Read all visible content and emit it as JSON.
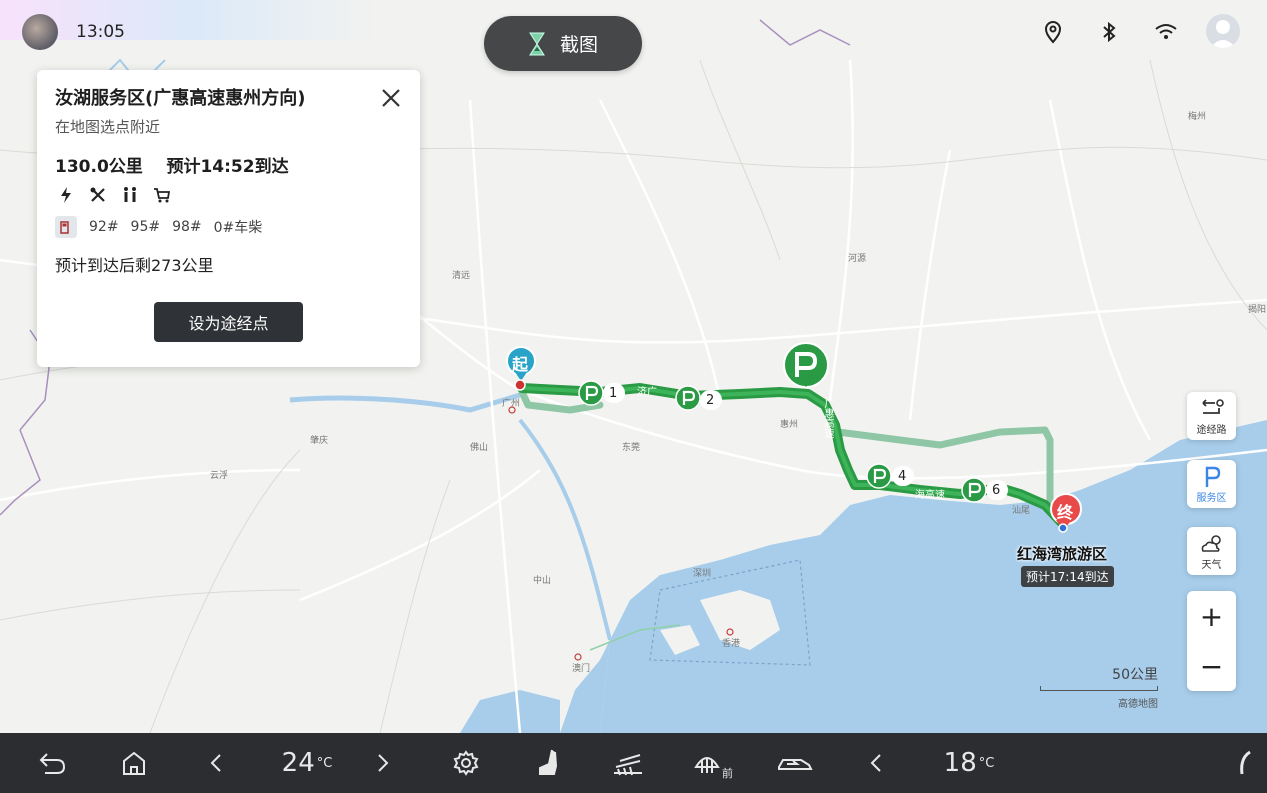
{
  "status": {
    "time": "13:05",
    "screenshot_label": "截图"
  },
  "card": {
    "title": "汝湖服务区(广惠高速惠州方向)",
    "subtitle": "在地图选点附近",
    "distance": "130.0公里",
    "eta": "预计14:52到达",
    "fuel": [
      "92#",
      "95#",
      "98#",
      "0#车柴"
    ],
    "remaining": "预计到达后剩273公里",
    "button": "设为途经点"
  },
  "side": {
    "waypoint": "途经路",
    "service_area": "服务区",
    "weather": "天气"
  },
  "map": {
    "start_marker": "起",
    "end_marker": "终",
    "destination": "红海湾旅游区",
    "dest_eta": "预计17:14到达",
    "scale": "50公里",
    "brand": "高德地图",
    "markers": [
      "1",
      "2",
      "4",
      "6"
    ],
    "cities": {
      "guangzhou": "广州",
      "foshan": "佛山",
      "dongguan": "东莞",
      "huizhou": "惠州",
      "shenzhen": "深圳",
      "zhongshan": "中山",
      "macau": "澳门",
      "hongkong": "香港",
      "zhaoqing": "肇庆",
      "yunfu": "云浮",
      "qingyuan": "清远",
      "heyuan": "河源",
      "meizhou": "梅州",
      "jieyang": "揭阳",
      "shanwei": "汕尾"
    },
    "road_labels": [
      "济广",
      "广惠高速",
      "海高速"
    ]
  },
  "bottom": {
    "driver_temp": "24",
    "passenger_temp": "18",
    "temp_unit": "°C",
    "front_defrost": "前"
  },
  "colors": {
    "route": "#2a9a44",
    "route_alt": "#8fc7a6",
    "sea": "#a7cdeb",
    "land": "#f2f3f0",
    "accent": "#3a86e6"
  }
}
